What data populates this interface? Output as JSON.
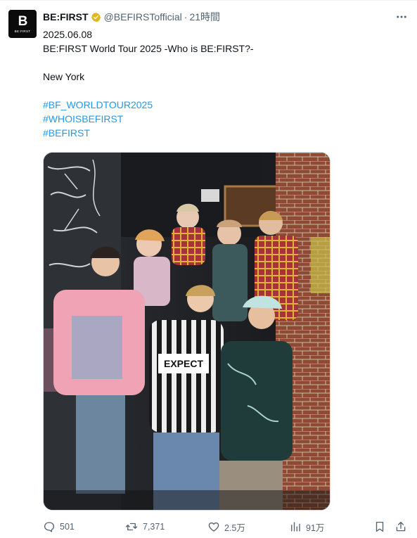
{
  "account": {
    "name": "BE:FIRST",
    "handle": "@BEFIRSTofficial",
    "separator": "·",
    "time": "21時間",
    "avatar_mono": "B",
    "avatar_text": "BE:FIRST",
    "verified_color": "#e2b719"
  },
  "post": {
    "date": "2025.06.08",
    "title": "BE:FIRST World Tour 2025 -Who is BE:FIRST?-",
    "location": "New York",
    "hashtags": [
      "#BF_WORLDTOUR2025",
      "#WHOISBEFIRST",
      "#BEFIRST"
    ]
  },
  "media": {
    "alt": "Group photo of seven members posing in a graffiti-covered backstage corridor",
    "shirt_text": "EXPECT"
  },
  "actions": {
    "replies": "501",
    "reposts": "7,371",
    "likes": "2.5万",
    "views": "91万"
  },
  "colors": {
    "link": "#1d9bf0",
    "muted": "#536471"
  }
}
